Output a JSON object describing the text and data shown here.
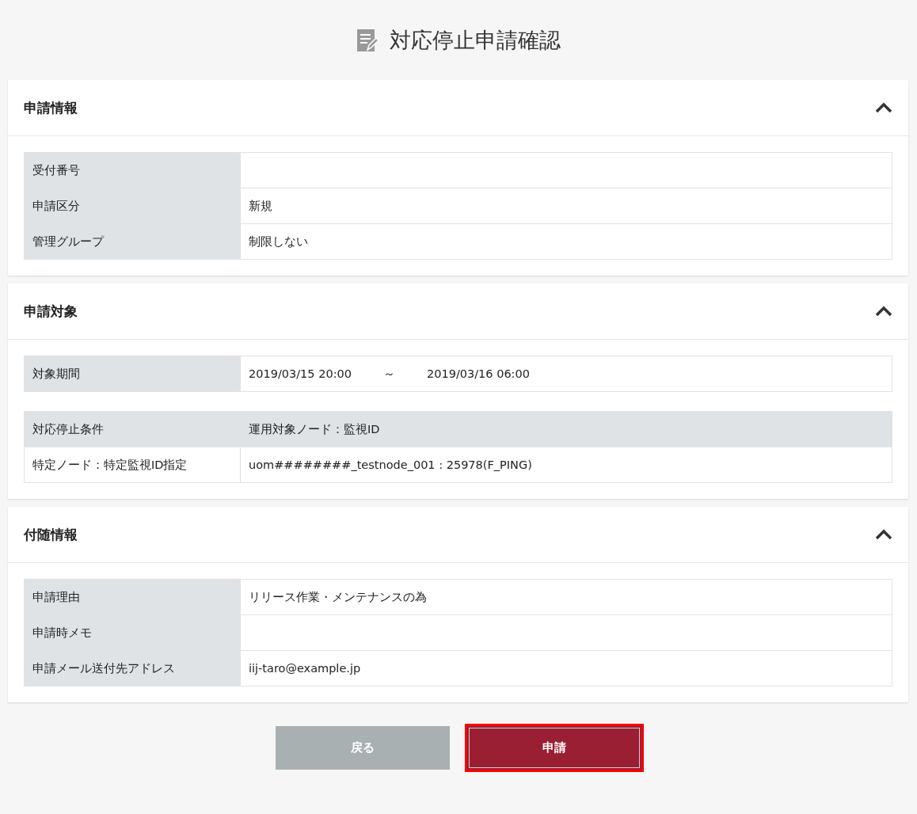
{
  "page": {
    "title": "対応停止申請確認"
  },
  "sections": [
    {
      "title": "申請情報",
      "expanded": true,
      "tables": [
        {
          "rows": [
            {
              "kind": "field",
              "label": "受付番号"
            },
            {
              "kind": "field",
              "label": "申請区分",
              "value": "新規"
            },
            {
              "kind": "field",
              "label": "管理グループ",
              "value": "制限しない"
            }
          ]
        }
      ]
    },
    {
      "title": "申請対象",
      "expanded": true,
      "tables": [
        {
          "rows": [
            {
              "kind": "field",
              "label": "対象期間",
              "parts": [
                "2019/03/15 20:00",
                "～",
                "2019/03/16 06:00"
              ]
            }
          ]
        },
        {
          "rows": [
            {
              "kind": "header",
              "label": "対応停止条件",
              "value": "運用対象ノード：監視ID"
            },
            {
              "kind": "data",
              "label": "特定ノード：特定監視ID指定",
              "value": "uom########_testnode_001 : 25978(F_PING)"
            }
          ]
        }
      ]
    },
    {
      "title": "付随情報",
      "expanded": true,
      "tables": [
        {
          "rows": [
            {
              "kind": "field",
              "label": "申請理由",
              "value": "リリース作業・メンテナンスの為"
            },
            {
              "kind": "field",
              "label": "申請時メモ"
            },
            {
              "kind": "field",
              "label": "申請メール送付先アドレス",
              "value": "iij-taro@example.jp"
            }
          ]
        }
      ]
    }
  ],
  "buttons": [
    {
      "label": "戻る",
      "kind": "secondary",
      "focused": false
    },
    {
      "label": "申請",
      "kind": "primary",
      "focused": true
    }
  ]
}
